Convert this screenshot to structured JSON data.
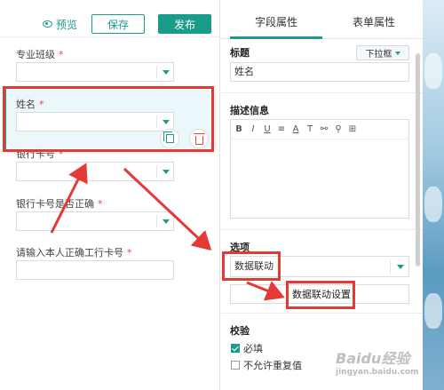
{
  "toolbar": {
    "preview_label": "预览",
    "save_label": "保存",
    "publish_label": "发布"
  },
  "form_fields": [
    {
      "label": "专业班级",
      "required_mark": "*"
    },
    {
      "label": "姓名",
      "required_mark": "*"
    },
    {
      "label": "银行卡号",
      "required_mark": "*"
    },
    {
      "label": "银行卡号是否正确",
      "required_mark": "*"
    },
    {
      "label": "请输入本人正确工行卡号",
      "required_mark": "*"
    }
  ],
  "right_panel": {
    "tabs": [
      "字段属性",
      "表单属性"
    ],
    "active_tab": 0,
    "title_section": "标题",
    "field_type": "下拉框",
    "title_value": "姓名",
    "description_section": "描述信息",
    "editor_tools": [
      "B",
      "I",
      "U",
      "≡",
      "A",
      "T",
      "⚯",
      "⚲",
      "⊞"
    ],
    "options_section": "选项",
    "option_value": "数据联动",
    "linkage_button": "数据联动设置",
    "validation_section": "校验",
    "checks": [
      {
        "label": "必填",
        "checked": true
      },
      {
        "label": "不允许重复值",
        "checked": false
      }
    ]
  },
  "watermark": {
    "text": "Baidu经验",
    "sub": "jingyan.baidu.com"
  },
  "colors": {
    "accent": "#1a9c8c",
    "annotation": "#e53935",
    "required": "#e04848",
    "selected_bg": "#eaf7fb"
  }
}
